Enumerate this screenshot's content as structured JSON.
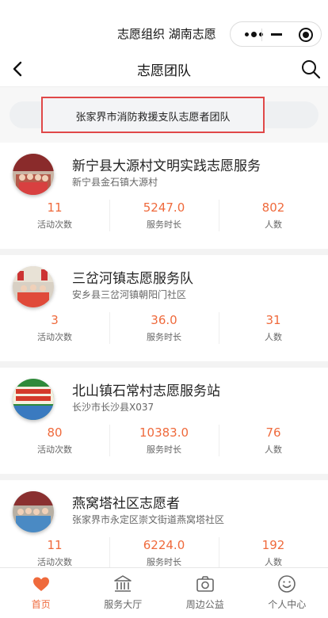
{
  "header": {
    "mini_program_title": "志愿组织 湖南志愿",
    "page_title": "志愿团队"
  },
  "search": {
    "text": "张家界市消防救援支队志愿者团队"
  },
  "teams": [
    {
      "name": "新宁县大源村文明实践志愿服务",
      "location": "新宁县金石镇大源村",
      "stats": [
        {
          "value": "11",
          "label": "活动次数"
        },
        {
          "value": "5247.0",
          "label": "服务时长"
        },
        {
          "value": "802",
          "label": "人数"
        }
      ]
    },
    {
      "name": "三岔河镇志愿服务队",
      "location": "安乡县三岔河镇朝阳门社区",
      "stats": [
        {
          "value": "3",
          "label": "活动次数"
        },
        {
          "value": "36.0",
          "label": "服务时长"
        },
        {
          "value": "31",
          "label": "人数"
        }
      ]
    },
    {
      "name": "北山镇石常村志愿服务站",
      "location": "长沙市长沙县X037",
      "stats": [
        {
          "value": "80",
          "label": "活动次数"
        },
        {
          "value": "10383.0",
          "label": "服务时长"
        },
        {
          "value": "76",
          "label": "人数"
        }
      ]
    },
    {
      "name": "燕窝塔社区志愿者",
      "location": "张家界市永定区崇文街道燕窝塔社区",
      "stats": [
        {
          "value": "11",
          "label": "活动次数"
        },
        {
          "value": "6224.0",
          "label": "服务时长"
        },
        {
          "value": "192",
          "label": "人数"
        }
      ]
    }
  ],
  "tabbar": [
    {
      "label": "首页",
      "icon": "heart-icon",
      "active": true
    },
    {
      "label": "服务大厅",
      "icon": "building-icon",
      "active": false
    },
    {
      "label": "周边公益",
      "icon": "camera-icon",
      "active": false
    },
    {
      "label": "个人中心",
      "icon": "smiley-icon",
      "active": false
    }
  ],
  "colors": {
    "accent": "#ef6a3c",
    "highlight_border": "#e04848"
  }
}
